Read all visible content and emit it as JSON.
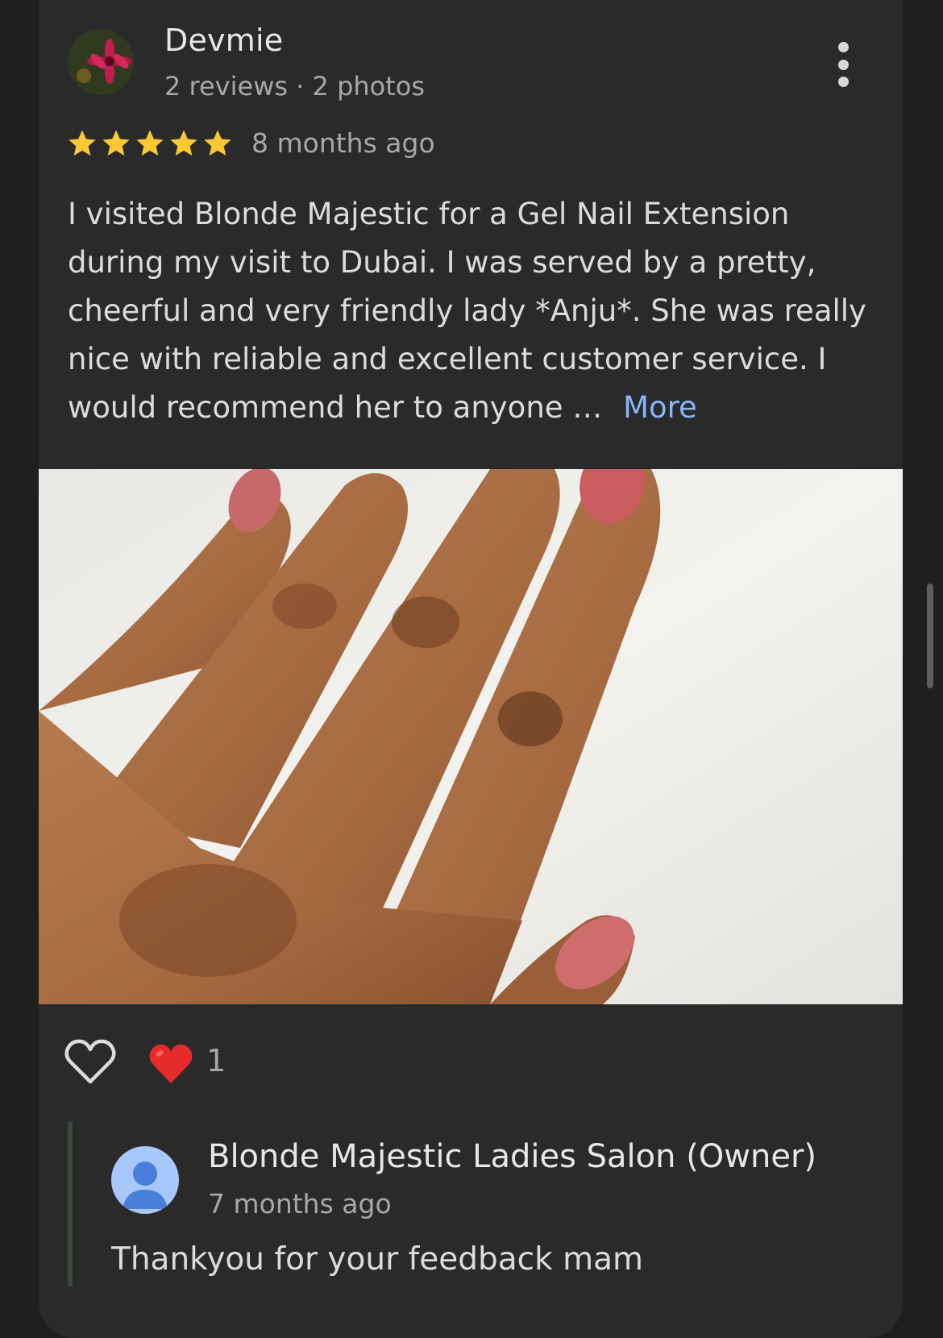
{
  "review": {
    "author": "Devmie",
    "author_meta": "2 reviews · 2 photos",
    "rating": 5,
    "rating_max": 5,
    "time_ago": "8 months ago",
    "text_lines": [
      "I visited Blonde Majestic for a Gel Nail Extension",
      "during my visit to Dubai. I was served by a pretty,",
      "cheerful and very friendly lady *Anju*. She was really",
      "nice with reliable and excellent customer service. I",
      "would recommend her to anyone … "
    ],
    "more_label": "More",
    "reactions": {
      "heart_count": "1"
    }
  },
  "owner_reply": {
    "name": "Blonde Majestic Ladies Salon (Owner)",
    "time_ago": "7 months ago",
    "text": "Thankyou for your feedback mam"
  },
  "colors": {
    "background": "#1f1f1f",
    "card": "#2a2a2b",
    "star": "#fcc934",
    "link": "#8ab4f8",
    "owner_avatar": "#a8c7fa",
    "owner_avatar_icon": "#4a7fd9"
  }
}
